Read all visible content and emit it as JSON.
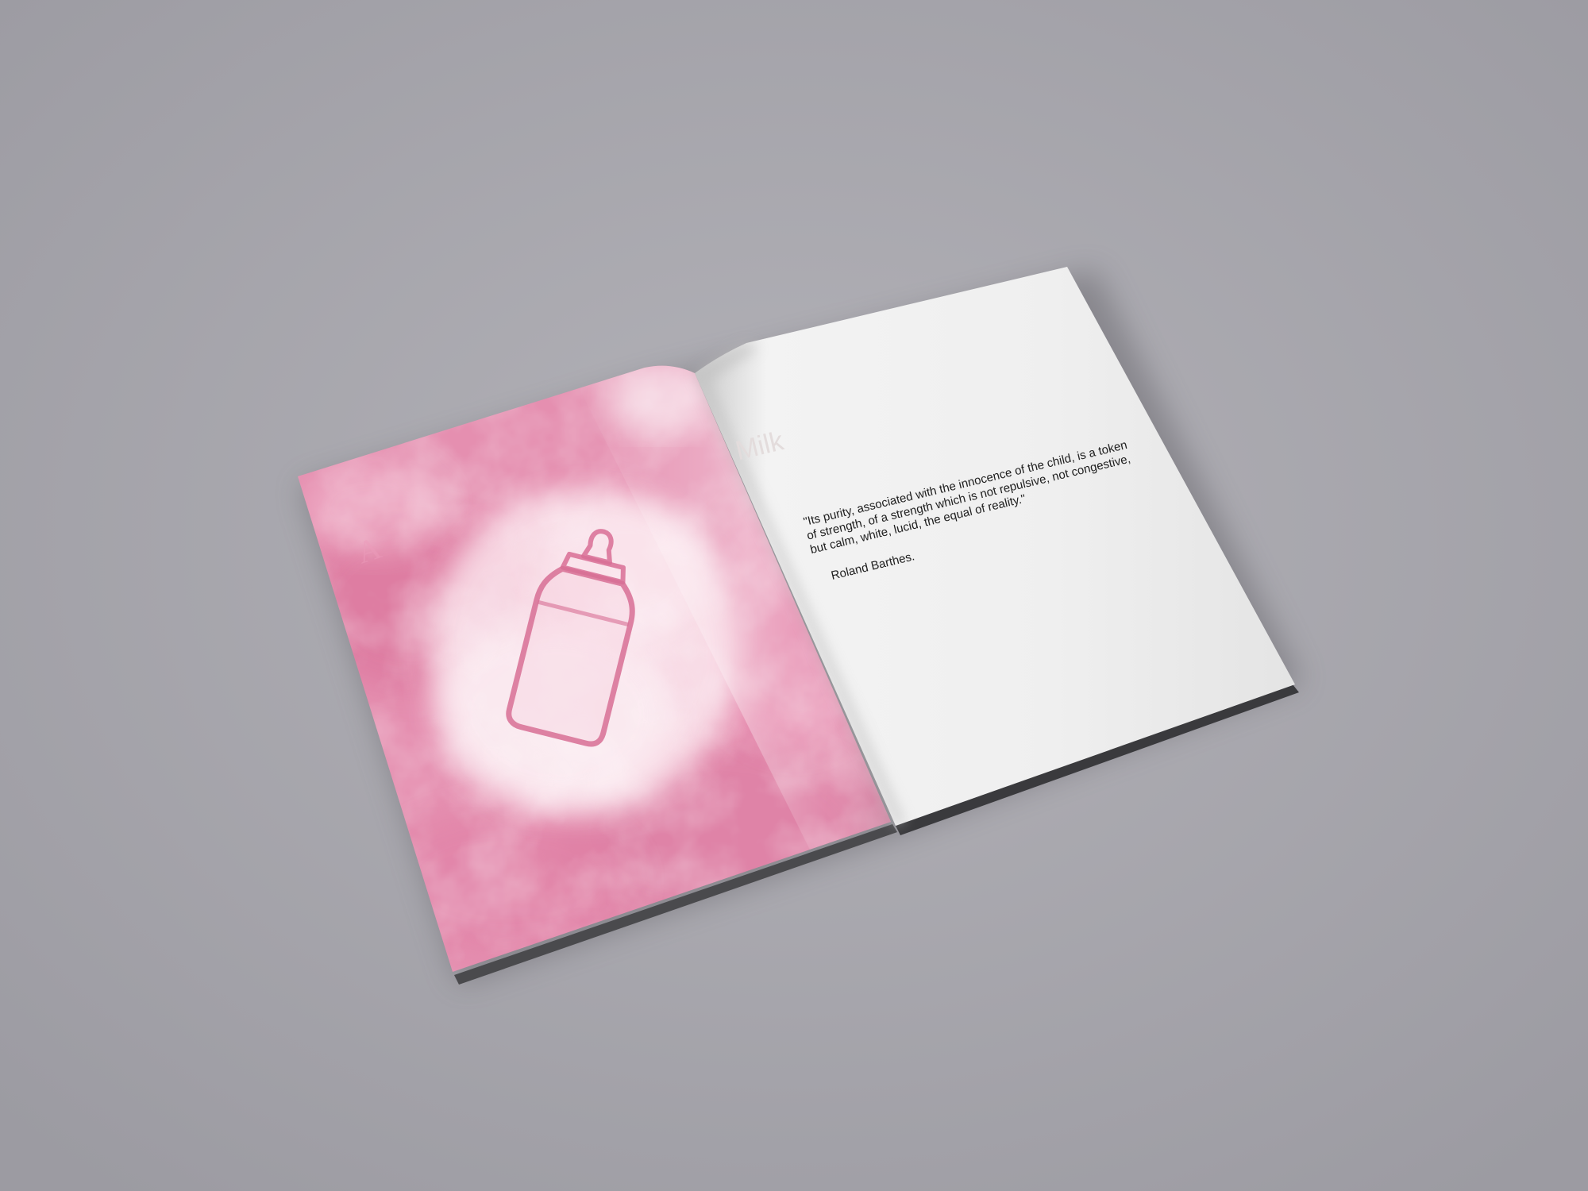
{
  "colors": {
    "background": "#a7a6ad",
    "left_page": "#e58fb0",
    "right_page": "#f1f1f1",
    "bottle_outline": "#d86f95"
  },
  "left_page": {
    "illustration": "baby-bottle-icon"
  },
  "right_page": {
    "title": "Milk",
    "quote_lines": [
      "\"Its purity, associated with the innocence of the child, is a token",
      "of strength, of a strength which is not repulsive, not congestive,",
      "but calm, white, lucid, the equal of reality.\""
    ],
    "author": "Roland Barthes."
  }
}
